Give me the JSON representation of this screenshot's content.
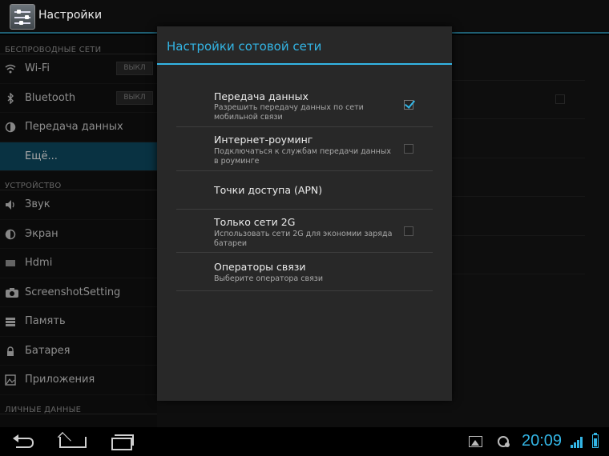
{
  "app_title": "Настройки",
  "sidebar": {
    "sections": {
      "wireless": "БЕСПРОВОДНЫЕ СЕТИ",
      "device": "УСТРОЙСТВО",
      "personal": "ЛИЧНЫЕ ДАННЫЕ"
    },
    "items": {
      "wifi": {
        "label": "Wi-Fi",
        "toggle": "ВЫКЛ",
        "icon": "wifi-icon"
      },
      "bluetooth": {
        "label": "Bluetooth",
        "toggle": "ВЫКЛ",
        "icon": "bluetooth-icon"
      },
      "data_usage": {
        "label": "Передача данных",
        "icon": "data-usage-icon"
      },
      "more": {
        "label": "Ещё..."
      },
      "sound": {
        "label": "Звук",
        "icon": "sound-icon"
      },
      "display": {
        "label": "Экран",
        "icon": "display-icon"
      },
      "hdmi": {
        "label": "Hdmi",
        "icon": "hdmi-icon"
      },
      "screenshot": {
        "label": "ScreenshotSetting",
        "icon": "camera-icon"
      },
      "storage": {
        "label": "Память",
        "icon": "storage-icon"
      },
      "battery": {
        "label": "Батарея",
        "icon": "battery-icon"
      },
      "apps": {
        "label": "Приложения",
        "icon": "apps-icon"
      }
    }
  },
  "dialog": {
    "title": "Настройки сотовой сети",
    "options": {
      "data_enabled": {
        "title": "Передача данных",
        "summary": "Разрешить передачу данных по сети мобильной связи",
        "checked": true
      },
      "roaming": {
        "title": "Интернет-роуминг",
        "summary": "Подключаться к службам передачи данных в роуминге",
        "checked": false
      },
      "apn": {
        "title": "Точки доступа (APN)"
      },
      "only_2g": {
        "title": "Только сети 2G",
        "summary": "Использовать сети 2G для экономии заряда батареи",
        "checked": false
      },
      "operators": {
        "title": "Операторы связи",
        "summary": "Выберите оператора связи"
      }
    }
  },
  "statusbar": {
    "time": "20:09",
    "accent": "#33b5e5"
  },
  "colors": {
    "accent": "#33b5e5",
    "selected": "#0f4d66"
  }
}
